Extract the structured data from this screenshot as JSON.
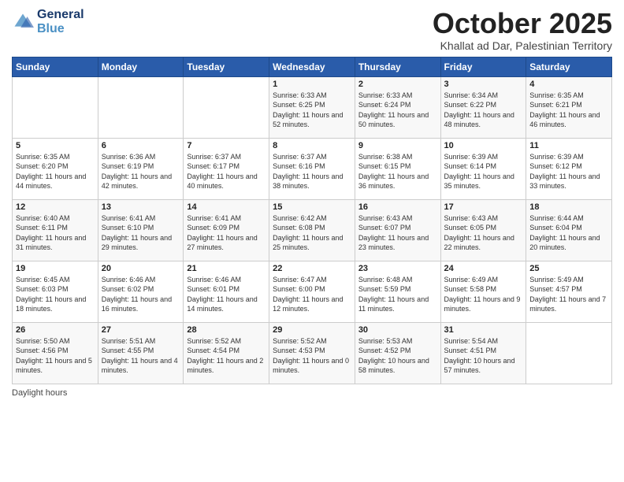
{
  "header": {
    "logo_line1": "General",
    "logo_line2": "Blue",
    "month": "October 2025",
    "location": "Khallat ad Dar, Palestinian Territory"
  },
  "days_of_week": [
    "Sunday",
    "Monday",
    "Tuesday",
    "Wednesday",
    "Thursday",
    "Friday",
    "Saturday"
  ],
  "weeks": [
    [
      {
        "num": "",
        "info": ""
      },
      {
        "num": "",
        "info": ""
      },
      {
        "num": "",
        "info": ""
      },
      {
        "num": "1",
        "info": "Sunrise: 6:33 AM\nSunset: 6:25 PM\nDaylight: 11 hours and 52 minutes."
      },
      {
        "num": "2",
        "info": "Sunrise: 6:33 AM\nSunset: 6:24 PM\nDaylight: 11 hours and 50 minutes."
      },
      {
        "num": "3",
        "info": "Sunrise: 6:34 AM\nSunset: 6:22 PM\nDaylight: 11 hours and 48 minutes."
      },
      {
        "num": "4",
        "info": "Sunrise: 6:35 AM\nSunset: 6:21 PM\nDaylight: 11 hours and 46 minutes."
      }
    ],
    [
      {
        "num": "5",
        "info": "Sunrise: 6:35 AM\nSunset: 6:20 PM\nDaylight: 11 hours and 44 minutes."
      },
      {
        "num": "6",
        "info": "Sunrise: 6:36 AM\nSunset: 6:19 PM\nDaylight: 11 hours and 42 minutes."
      },
      {
        "num": "7",
        "info": "Sunrise: 6:37 AM\nSunset: 6:17 PM\nDaylight: 11 hours and 40 minutes."
      },
      {
        "num": "8",
        "info": "Sunrise: 6:37 AM\nSunset: 6:16 PM\nDaylight: 11 hours and 38 minutes."
      },
      {
        "num": "9",
        "info": "Sunrise: 6:38 AM\nSunset: 6:15 PM\nDaylight: 11 hours and 36 minutes."
      },
      {
        "num": "10",
        "info": "Sunrise: 6:39 AM\nSunset: 6:14 PM\nDaylight: 11 hours and 35 minutes."
      },
      {
        "num": "11",
        "info": "Sunrise: 6:39 AM\nSunset: 6:12 PM\nDaylight: 11 hours and 33 minutes."
      }
    ],
    [
      {
        "num": "12",
        "info": "Sunrise: 6:40 AM\nSunset: 6:11 PM\nDaylight: 11 hours and 31 minutes."
      },
      {
        "num": "13",
        "info": "Sunrise: 6:41 AM\nSunset: 6:10 PM\nDaylight: 11 hours and 29 minutes."
      },
      {
        "num": "14",
        "info": "Sunrise: 6:41 AM\nSunset: 6:09 PM\nDaylight: 11 hours and 27 minutes."
      },
      {
        "num": "15",
        "info": "Sunrise: 6:42 AM\nSunset: 6:08 PM\nDaylight: 11 hours and 25 minutes."
      },
      {
        "num": "16",
        "info": "Sunrise: 6:43 AM\nSunset: 6:07 PM\nDaylight: 11 hours and 23 minutes."
      },
      {
        "num": "17",
        "info": "Sunrise: 6:43 AM\nSunset: 6:05 PM\nDaylight: 11 hours and 22 minutes."
      },
      {
        "num": "18",
        "info": "Sunrise: 6:44 AM\nSunset: 6:04 PM\nDaylight: 11 hours and 20 minutes."
      }
    ],
    [
      {
        "num": "19",
        "info": "Sunrise: 6:45 AM\nSunset: 6:03 PM\nDaylight: 11 hours and 18 minutes."
      },
      {
        "num": "20",
        "info": "Sunrise: 6:46 AM\nSunset: 6:02 PM\nDaylight: 11 hours and 16 minutes."
      },
      {
        "num": "21",
        "info": "Sunrise: 6:46 AM\nSunset: 6:01 PM\nDaylight: 11 hours and 14 minutes."
      },
      {
        "num": "22",
        "info": "Sunrise: 6:47 AM\nSunset: 6:00 PM\nDaylight: 11 hours and 12 minutes."
      },
      {
        "num": "23",
        "info": "Sunrise: 6:48 AM\nSunset: 5:59 PM\nDaylight: 11 hours and 11 minutes."
      },
      {
        "num": "24",
        "info": "Sunrise: 6:49 AM\nSunset: 5:58 PM\nDaylight: 11 hours and 9 minutes."
      },
      {
        "num": "25",
        "info": "Sunrise: 5:49 AM\nSunset: 4:57 PM\nDaylight: 11 hours and 7 minutes."
      }
    ],
    [
      {
        "num": "26",
        "info": "Sunrise: 5:50 AM\nSunset: 4:56 PM\nDaylight: 11 hours and 5 minutes."
      },
      {
        "num": "27",
        "info": "Sunrise: 5:51 AM\nSunset: 4:55 PM\nDaylight: 11 hours and 4 minutes."
      },
      {
        "num": "28",
        "info": "Sunrise: 5:52 AM\nSunset: 4:54 PM\nDaylight: 11 hours and 2 minutes."
      },
      {
        "num": "29",
        "info": "Sunrise: 5:52 AM\nSunset: 4:53 PM\nDaylight: 11 hours and 0 minutes."
      },
      {
        "num": "30",
        "info": "Sunrise: 5:53 AM\nSunset: 4:52 PM\nDaylight: 10 hours and 58 minutes."
      },
      {
        "num": "31",
        "info": "Sunrise: 5:54 AM\nSunset: 4:51 PM\nDaylight: 10 hours and 57 minutes."
      },
      {
        "num": "",
        "info": ""
      }
    ]
  ],
  "footer": {
    "daylight_label": "Daylight hours"
  }
}
